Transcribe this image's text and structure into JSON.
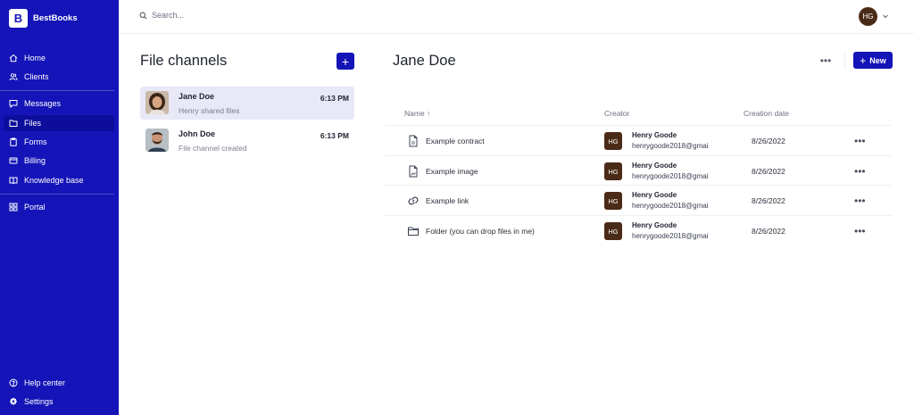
{
  "brand": {
    "logo_letter": "B",
    "name": "BestBooks"
  },
  "sidebar": {
    "items": [
      {
        "label": "Home",
        "icon": "home-icon"
      },
      {
        "label": "Clients",
        "icon": "users-icon"
      },
      {
        "label": "Messages",
        "icon": "message-icon"
      },
      {
        "label": "Files",
        "icon": "folder-icon",
        "active": true
      },
      {
        "label": "Forms",
        "icon": "clipboard-icon"
      },
      {
        "label": "Billing",
        "icon": "card-icon"
      },
      {
        "label": "Knowledge base",
        "icon": "book-icon"
      },
      {
        "label": "Portal",
        "icon": "grid-icon"
      }
    ],
    "bottom": [
      {
        "label": "Help center",
        "icon": "help-icon"
      },
      {
        "label": "Settings",
        "icon": "gear-icon"
      }
    ]
  },
  "topbar": {
    "search_placeholder": "Search...",
    "user_initials": "HG"
  },
  "channels": {
    "title": "File channels",
    "add_label": "+",
    "items": [
      {
        "name": "Jane Doe",
        "subtitle": "Henry shared files",
        "time": "6:13 PM",
        "active": true
      },
      {
        "name": "John Doe",
        "subtitle": "File channel created",
        "time": "6:13 PM",
        "active": false
      }
    ]
  },
  "main": {
    "title": "Jane Doe",
    "more_label": "•••",
    "new_plus": "+",
    "new_label": "New",
    "columns": {
      "name": "Name ↑",
      "creator": "Creator",
      "date": "Creation date"
    },
    "rows": [
      {
        "icon": "document-icon",
        "name": "Example contract",
        "creator_initials": "HG",
        "creator_name": "Henry Goode",
        "creator_email": "henrygoode2018@gmai",
        "date": "8/26/2022",
        "more": "•••"
      },
      {
        "icon": "image-file-icon",
        "name": "Example image",
        "creator_initials": "HG",
        "creator_name": "Henry Goode",
        "creator_email": "henrygoode2018@gmai",
        "date": "8/26/2022",
        "more": "•••"
      },
      {
        "icon": "link-icon",
        "name": "Example link",
        "creator_initials": "HG",
        "creator_name": "Henry Goode",
        "creator_email": "henrygoode2018@gmai",
        "date": "8/26/2022",
        "more": "•••"
      },
      {
        "icon": "folder-icon",
        "name": "Folder (you can drop files in me)",
        "creator_initials": "HG",
        "creator_name": "Henry Goode",
        "creator_email": "henrygoode2018@gmai",
        "date": "8/26/2022",
        "more": "•••"
      }
    ]
  }
}
